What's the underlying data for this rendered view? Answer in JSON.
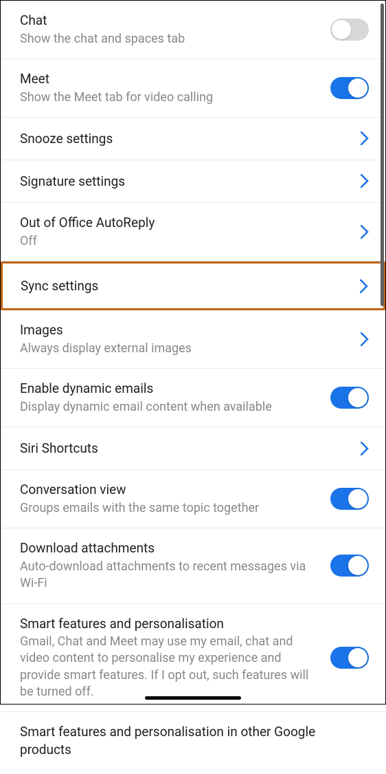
{
  "settings": {
    "chat": {
      "title": "Chat",
      "subtitle": "Show the chat and spaces tab",
      "enabled": false
    },
    "meet": {
      "title": "Meet",
      "subtitle": "Show the Meet tab for video calling",
      "enabled": true
    },
    "snooze": {
      "title": "Snooze settings"
    },
    "signature": {
      "title": "Signature settings"
    },
    "outOfOffice": {
      "title": "Out of Office AutoReply",
      "subtitle": "Off"
    },
    "sync": {
      "title": "Sync settings"
    },
    "images": {
      "title": "Images",
      "subtitle": "Always display external images"
    },
    "dynamicEmails": {
      "title": "Enable dynamic emails",
      "subtitle": "Display dynamic email content when available",
      "enabled": true
    },
    "siri": {
      "title": "Siri Shortcuts"
    },
    "conversationView": {
      "title": "Conversation view",
      "subtitle": "Groups emails with the same topic together",
      "enabled": true
    },
    "downloadAttachments": {
      "title": "Download attachments",
      "subtitle": "Auto-download attachments to recent messages via Wi-Fi",
      "enabled": true
    },
    "smartFeatures": {
      "title": "Smart features and personalisation",
      "subtitle": "Gmail, Chat and Meet may use my email, chat and video content to personalise my experience and provide smart features. If I opt out, such features will be turned off.",
      "enabled": true
    },
    "smartFeaturesOther": {
      "title": "Smart features and personalisation in other Google products"
    }
  },
  "colors": {
    "toggleOn": "#1a73e8",
    "chevron": "#1a73e8",
    "highlight": "#c06515"
  }
}
